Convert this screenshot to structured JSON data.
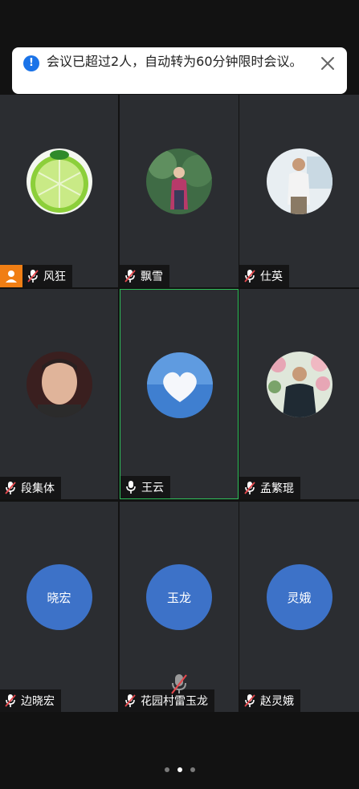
{
  "banner": {
    "text": "会议已超过2人，自动转为60分钟限时会议。"
  },
  "participants": [
    {
      "name": "风狂",
      "type": "photo",
      "photo": "lime-slice",
      "muted": true,
      "host": true,
      "active": false
    },
    {
      "name": "飘雪",
      "type": "photo",
      "photo": "woman-in-forest",
      "muted": true,
      "host": false,
      "active": false
    },
    {
      "name": "仕英",
      "type": "photo",
      "photo": "man-outdoors",
      "muted": true,
      "host": false,
      "active": false
    },
    {
      "name": "段集体",
      "type": "photo",
      "photo": "man-portrait",
      "muted": true,
      "host": false,
      "active": false
    },
    {
      "name": "王云",
      "type": "photo",
      "photo": "heart-cloud",
      "muted": false,
      "host": false,
      "active": true
    },
    {
      "name": "孟繁琨",
      "type": "photo",
      "photo": "man-flowers",
      "muted": true,
      "host": false,
      "active": false
    },
    {
      "name": "边晓宏",
      "type": "initial",
      "initial": "晓宏",
      "muted": true,
      "host": false,
      "active": false
    },
    {
      "name": "花园村雷玉龙",
      "type": "initial",
      "initial": "玉龙",
      "muted": true,
      "host": false,
      "active": false
    },
    {
      "name": "赵灵娥",
      "type": "initial",
      "initial": "灵娥",
      "muted": true,
      "host": false,
      "active": false
    }
  ],
  "pager": {
    "count": 3,
    "active": 1
  },
  "colors": {
    "tile": "#2b2d31",
    "avatar": "#3d72c8",
    "active_border": "#2fbf5a",
    "host_badge": "#f07e14",
    "mute": "#e5484d"
  }
}
